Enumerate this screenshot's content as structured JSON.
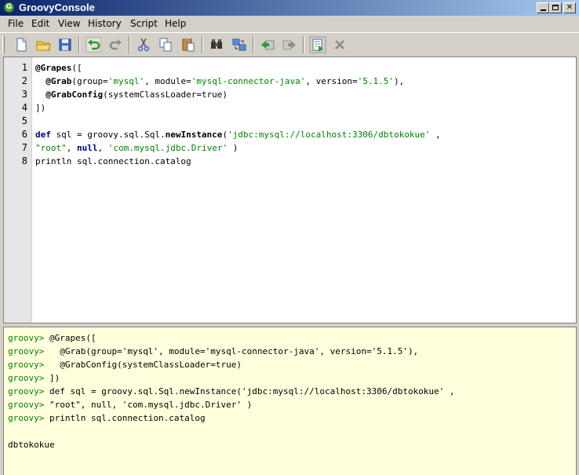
{
  "window": {
    "title": "GroovyConsole",
    "icon": "groovy-logo-icon"
  },
  "menu": [
    "File",
    "Edit",
    "View",
    "History",
    "Script",
    "Help"
  ],
  "toolbar": {
    "tools": [
      "new-file-icon",
      "open-folder-icon",
      "save-icon",
      "undo-icon",
      "redo-icon",
      "cut-icon",
      "copy-icon",
      "paste-icon",
      "find-icon",
      "replace-icon",
      "history-previous-icon",
      "history-next-icon",
      "run-script-icon",
      "interrupt-icon"
    ]
  },
  "editor": {
    "line_numbers": [
      "1",
      "2",
      "3",
      "4",
      "5",
      "6",
      "7",
      "8"
    ],
    "lines": [
      [
        {
          "t": "@Grapes",
          "c": "ann"
        },
        {
          "t": "([",
          "c": "p"
        }
      ],
      [
        {
          "t": "  ",
          "c": "p"
        },
        {
          "t": "@Grab",
          "c": "ann"
        },
        {
          "t": "(group=",
          "c": "p"
        },
        {
          "t": "'mysql'",
          "c": "str"
        },
        {
          "t": ", module=",
          "c": "p"
        },
        {
          "t": "'mysql-connector-java'",
          "c": "str"
        },
        {
          "t": ", version=",
          "c": "p"
        },
        {
          "t": "'5.1.5'",
          "c": "str"
        },
        {
          "t": "),",
          "c": "p"
        }
      ],
      [
        {
          "t": "  ",
          "c": "p"
        },
        {
          "t": "@GrabConfig",
          "c": "ann"
        },
        {
          "t": "(systemClassLoader=true)",
          "c": "p"
        }
      ],
      [
        {
          "t": "])",
          "c": "p"
        }
      ],
      [],
      [
        {
          "t": "def",
          "c": "kw"
        },
        {
          "t": " sql = groovy.sql.Sql.",
          "c": "p"
        },
        {
          "t": "newInstance",
          "c": "meth"
        },
        {
          "t": "(",
          "c": "p"
        },
        {
          "t": "'jdbc:mysql://localhost:3306/dbtokokue'",
          "c": "str"
        },
        {
          "t": " ,",
          "c": "p"
        }
      ],
      [
        {
          "t": "\"root\"",
          "c": "str"
        },
        {
          "t": ", ",
          "c": "p"
        },
        {
          "t": "null",
          "c": "kw"
        },
        {
          "t": ", ",
          "c": "p"
        },
        {
          "t": "'com.mysql.jdbc.Driver'",
          "c": "str"
        },
        {
          "t": " )",
          "c": "p"
        }
      ],
      [
        {
          "t": "println sql.connection.catalog",
          "c": "p"
        }
      ]
    ]
  },
  "output": {
    "prompt": "groovy>",
    "echo_lines": [
      " @Grapes([",
      "   @Grab(group='mysql', module='mysql-connector-java', version='5.1.5'),",
      "   @GrabConfig(systemClassLoader=true)",
      " ])",
      " def sql = groovy.sql.Sql.newInstance('jdbc:mysql://localhost:3306/dbtokokue' ,",
      " \"root\", null, 'com.mysql.jdbc.Driver' )",
      " println sql.connection.catalog"
    ],
    "result": "dbtokokue"
  }
}
